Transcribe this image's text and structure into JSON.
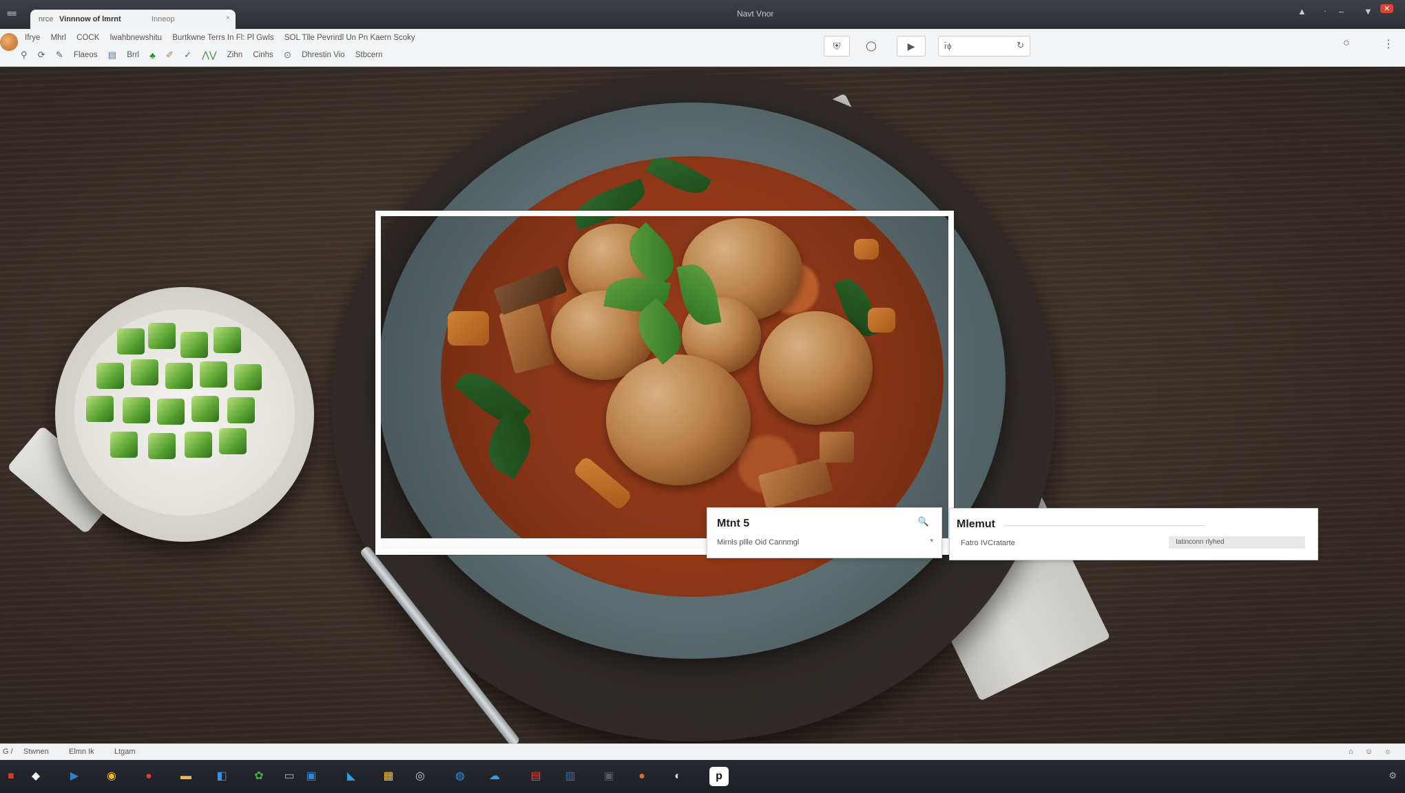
{
  "titlebar": {
    "menu_glyph": "≡≡",
    "tab": {
      "prefix": "nrce",
      "title": "Vinnnow of lmrnt",
      "extra": "Inneop",
      "close": "×"
    },
    "window_title": "Navt Vnor",
    "controls": [
      "▲",
      "ᐧ",
      "–",
      "▼",
      "✕"
    ]
  },
  "toolbar": {
    "row1": [
      "Ifrye",
      "Mhrl",
      "COCK",
      "lwahbnewshitu",
      "Burtkwne Terrs In Fl: Pl Gwls",
      "SOL Tlle Pevrirdl Un Pn Kaern Scoky"
    ],
    "row2": [
      "Flaeos",
      "Brrl",
      "Zihn",
      "Cinhs",
      "Dhrestin Vio",
      "Stbcern"
    ],
    "row2_icons": [
      "mic-icon",
      "refresh-icon",
      "pen-icon",
      "doc-icon",
      "leaf-icon",
      "check-icon",
      "chart-icon"
    ],
    "right_buttons": [
      {
        "name": "shield-button",
        "glyph": "⛨"
      },
      {
        "name": "search-circle-button",
        "glyph": "◯"
      },
      {
        "name": "play-button",
        "glyph": "▶"
      }
    ],
    "search": {
      "label": "r̄ɸ",
      "icon": "↻"
    },
    "circle_glyph": "○",
    "menu_glyph": "⋮"
  },
  "popup_left": {
    "title": "Mtnt 5",
    "subtitle": "Mirnls pllle Oid Cannmgl",
    "search_glyph": "🔍",
    "dropdown_glyph": "▾"
  },
  "popup_right": {
    "title": "Mlemut",
    "subtitle": "Fatro IVCratarte",
    "status": "Iatinconn rlyhed"
  },
  "statusbar": {
    "left": [
      "G /",
      "Stwnen",
      "Elmn Ik",
      "Ltgam"
    ],
    "right": [
      "⌂",
      "☺",
      "☼"
    ]
  },
  "taskbar": {
    "apps": [
      {
        "name": "app-red-icon",
        "glyph": "■",
        "color": "#d8382f"
      },
      {
        "name": "app-fox-icon",
        "glyph": "◆",
        "color": "#f2f2f2"
      },
      {
        "name": "app-blue-play-icon",
        "glyph": "▶",
        "color": "#2f7fd1"
      },
      {
        "name": "app-chrome-icon",
        "glyph": "◉",
        "color": "#f0b429"
      },
      {
        "name": "app-record-icon",
        "glyph": "●",
        "color": "#d83b3b"
      },
      {
        "name": "app-folder-icon",
        "glyph": "▬",
        "color": "#e7b84a"
      },
      {
        "name": "app-browser-icon",
        "glyph": "◧",
        "color": "#3a8ee6"
      },
      {
        "name": "app-palette-icon",
        "glyph": "✿",
        "color": "#4fae4a"
      },
      {
        "name": "app-window-icon",
        "glyph": "▭",
        "color": "#9fb5c9"
      },
      {
        "name": "app-blue-window-icon",
        "glyph": "▣",
        "color": "#2e86de"
      },
      {
        "name": "app-vscode-icon",
        "glyph": "◣",
        "color": "#2d9be3"
      },
      {
        "name": "app-calendar-icon",
        "glyph": "▦",
        "color": "#f0c040"
      },
      {
        "name": "app-headset-icon",
        "glyph": "◎",
        "color": "#cccccc"
      },
      {
        "name": "app-globe-icon",
        "glyph": "◍",
        "color": "#2f8fe0"
      },
      {
        "name": "app-cloud-icon",
        "glyph": "☁",
        "color": "#3a9be0"
      },
      {
        "name": "app-doc-icon",
        "glyph": "▤",
        "color": "#e24a3b"
      },
      {
        "name": "app-store-icon",
        "glyph": "▥",
        "color": "#3a6ea5"
      },
      {
        "name": "app-terminal-icon",
        "glyph": "▣",
        "color": "#555c66"
      },
      {
        "name": "app-fruit-icon",
        "glyph": "●",
        "color": "#e06b2f"
      },
      {
        "name": "app-moon-icon",
        "glyph": "◐",
        "color": "#dddddd"
      },
      {
        "name": "app-p-icon",
        "glyph": "p",
        "color": "#ffffff"
      }
    ],
    "tray": "⚙"
  }
}
